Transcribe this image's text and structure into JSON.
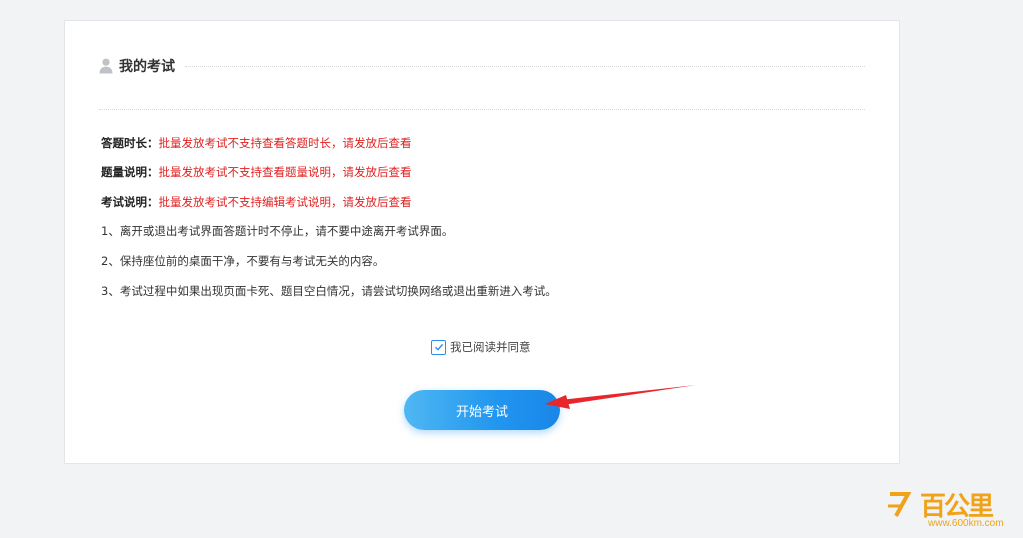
{
  "section": {
    "title": "我的考试"
  },
  "info": [
    {
      "label": "答题时长：",
      "value": "批量发放考试不支持查看答题时长，请发放后查看"
    },
    {
      "label": "题量说明：",
      "value": "批量发放考试不支持查看题量说明，请发放后查看"
    },
    {
      "label": "考试说明：",
      "value": "批量发放考试不支持编辑考试说明，请发放后查看"
    }
  ],
  "rules": [
    "1、离开或退出考试界面答题计时不停止，请不要中途离开考试界面。",
    "2、保持座位前的桌面干净，不要有与考试无关的内容。",
    "3、考试过程中如果出现页面卡死、题目空白情况，请尝试切换网络或退出重新进入考试。"
  ],
  "agreement": {
    "label": "我已阅读并同意",
    "checked": true
  },
  "start_button": {
    "label": "开始考试"
  },
  "watermark": {
    "logo": "百公里",
    "url": "www.600km.com"
  },
  "colors": {
    "accent": "#2196ef",
    "warning_text": "#e02020",
    "arrow": "#e8262b",
    "watermark": "#f0a21b"
  }
}
